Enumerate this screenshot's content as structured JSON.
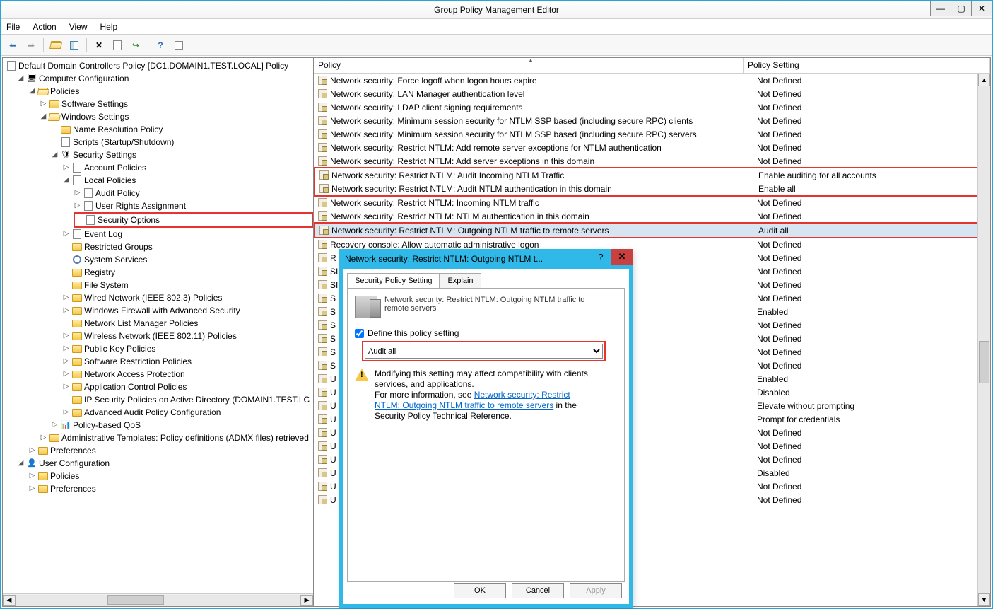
{
  "window": {
    "title": "Group Policy Management Editor"
  },
  "menu": {
    "file": "File",
    "action": "Action",
    "view": "View",
    "help": "Help"
  },
  "tree": {
    "root": "Default Domain Controllers Policy [DC1.DOMAIN1.TEST.LOCAL] Policy",
    "compconf": "Computer Configuration",
    "policies": "Policies",
    "softset": "Software Settings",
    "winset": "Windows Settings",
    "nrp": "Name Resolution Policy",
    "scripts": "Scripts (Startup/Shutdown)",
    "secset": "Security Settings",
    "acct": "Account Policies",
    "localpol": "Local Policies",
    "audit": "Audit Policy",
    "ura": "User Rights Assignment",
    "secopt": "Security Options",
    "evlog": "Event Log",
    "rg": "Restricted Groups",
    "syssvc": "System Services",
    "reg": "Registry",
    "fs": "File System",
    "wired": "Wired Network (IEEE 802.3) Policies",
    "wfas": "Windows Firewall with Advanced Security",
    "nlmp": "Network List Manager Policies",
    "wireless": "Wireless Network (IEEE 802.11) Policies",
    "pkp": "Public Key Policies",
    "srp": "Software Restriction Policies",
    "nap": "Network Access Protection",
    "acp": "Application Control Policies",
    "ipsec": "IP Security Policies on Active Directory (DOMAIN1.TEST.LC",
    "aapc": "Advanced Audit Policy Configuration",
    "pbqos": "Policy-based QoS",
    "admx": "Administrative Templates: Policy definitions (ADMX files) retrieved",
    "prefs": "Preferences",
    "userconf": "User Configuration",
    "upolicies": "Policies",
    "uprefs": "Preferences"
  },
  "list": {
    "h1": "Policy",
    "h2": "Policy Setting",
    "rows": [
      {
        "p": "Network security: Force logoff when logon hours expire",
        "s": "Not Defined"
      },
      {
        "p": "Network security: LAN Manager authentication level",
        "s": "Not Defined"
      },
      {
        "p": "Network security: LDAP client signing requirements",
        "s": "Not Defined"
      },
      {
        "p": "Network security: Minimum session security for NTLM SSP based (including secure RPC) clients",
        "s": "Not Defined"
      },
      {
        "p": "Network security: Minimum session security for NTLM SSP based (including secure RPC) servers",
        "s": "Not Defined"
      },
      {
        "p": "Network security: Restrict NTLM: Add remote server exceptions for NTLM authentication",
        "s": "Not Defined"
      },
      {
        "p": "Network security: Restrict NTLM: Add server exceptions in this domain",
        "s": "Not Defined"
      },
      {
        "p": "Network security: Restrict NTLM: Audit Incoming NTLM Traffic",
        "s": "Enable auditing for all accounts"
      },
      {
        "p": "Network security: Restrict NTLM: Audit NTLM authentication in this domain",
        "s": "Enable all"
      },
      {
        "p": "Network security: Restrict NTLM: Incoming NTLM traffic",
        "s": "Not Defined"
      },
      {
        "p": "Network security: Restrict NTLM: NTLM authentication in this domain",
        "s": "Not Defined"
      },
      {
        "p": "Network security: Restrict NTLM: Outgoing NTLM traffic to remote servers",
        "s": "Audit all"
      },
      {
        "p": "Recovery console: Allow automatic administrative logon",
        "s": "Not Defined"
      },
      {
        "p": "R",
        "s": "Not Defined"
      },
      {
        "p": "SI",
        "s": "Not Defined"
      },
      {
        "p": "SI",
        "s": "Not Defined"
      },
      {
        "p": "S                                                                                                                                uter",
        "s": "Not Defined"
      },
      {
        "p": "S                                                                                                                                igning",
        "s": "Enabled"
      },
      {
        "p": "S",
        "s": "Not Defined"
      },
      {
        "p": "S                                                                                                                                bolic Links)",
        "s": "Not Defined"
      },
      {
        "p": "S",
        "s": "Not Defined"
      },
      {
        "p": "S                                                                                                                                on Policies",
        "s": "Not Defined"
      },
      {
        "p": "U                                                                                                                                t",
        "s": "Enabled"
      },
      {
        "p": "U                                                                                                                                using the secure desktop",
        "s": "Disabled"
      },
      {
        "p": "U                                                                                                                                n Approval Mode",
        "s": "Elevate without prompting"
      },
      {
        "p": "U",
        "s": "Prompt for credentials"
      },
      {
        "p": "U",
        "s": "Not Defined"
      },
      {
        "p": "U",
        "s": "Not Defined"
      },
      {
        "p": "U                                                                                                                                e locations",
        "s": "Not Defined"
      },
      {
        "p": "U",
        "s": "Disabled"
      },
      {
        "p": "U",
        "s": "Not Defined"
      },
      {
        "p": "U",
        "s": "Not Defined"
      }
    ]
  },
  "dialog": {
    "title": "Network security: Restrict NTLM: Outgoing NTLM t...",
    "tab1": "Security Policy Setting",
    "tab2": "Explain",
    "policy_name": "Network security: Restrict NTLM: Outgoing NTLM traffic to remote servers",
    "define": "Define this policy setting",
    "select_value": "Audit all",
    "warn": "Modifying this setting may affect compatibility with clients, services, and applications.",
    "warn_more": "For more information, see ",
    "warn_link": "Network security: Restrict NTLM: Outgoing NTLM traffic to remote servers",
    "warn_tail": " in the Security Policy Technical Reference.",
    "ok": "OK",
    "cancel": "Cancel",
    "apply": "Apply"
  }
}
